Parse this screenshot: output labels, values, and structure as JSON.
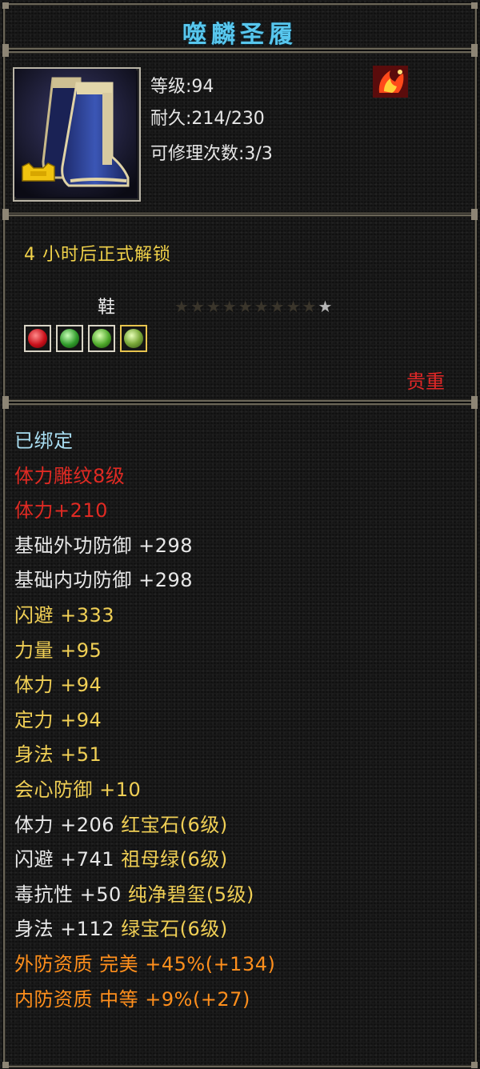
{
  "colors": {
    "title": "#58c7ee",
    "red": "#e02a23",
    "gold": "#f0cf55",
    "orange": "#ff8f1c",
    "cyan": "#a9def2"
  },
  "item": {
    "name": "噬麟圣履",
    "icon": "blue-boots-icon",
    "level": "等级:94",
    "durability": "耐久:214/230",
    "repair": "可修理次数:3/3",
    "badge_icon": "fire-emblem-icon"
  },
  "unlock": {
    "text": "4 小时后正式解锁",
    "slot": "鞋",
    "stars_total": 10,
    "stars_lit": 1,
    "gems": [
      "red-gem-icon",
      "green-gem-icon",
      "green-gem-icon",
      "jade-gem-icon"
    ],
    "quality": "贵重"
  },
  "attributes": [
    {
      "text": "已绑定",
      "color": "cyan"
    },
    {
      "text": "体力雕纹8级",
      "color": "red"
    },
    {
      "text": "体力+210",
      "color": "red"
    },
    {
      "text": "基础外功防御 +298",
      "color": "white"
    },
    {
      "text": "基础内功防御 +298",
      "color": "white"
    },
    {
      "text": "闪避 +333",
      "color": "gold"
    },
    {
      "text": "力量 +95",
      "color": "gold"
    },
    {
      "text": "体力 +94",
      "color": "gold"
    },
    {
      "text": "定力 +94",
      "color": "gold"
    },
    {
      "text": "身法 +51",
      "color": "gold"
    },
    {
      "text": "会心防御 +10",
      "color": "gold"
    },
    {
      "text": "体力 +206 ",
      "extra": "红宝石(6级)",
      "color": "white"
    },
    {
      "text": "闪避 +741 ",
      "extra": "祖母绿(6级)",
      "color": "white"
    },
    {
      "text": "毒抗性 +50 ",
      "extra": "纯净碧玺(5级)",
      "color": "white"
    },
    {
      "text": "身法 +112 ",
      "extra": "绿宝石(6级)",
      "color": "white"
    },
    {
      "text": "外防资质  完美 +45%(+134)",
      "color": "orange"
    },
    {
      "text": "内防资质  中等 +9%(+27)",
      "color": "orange"
    }
  ]
}
